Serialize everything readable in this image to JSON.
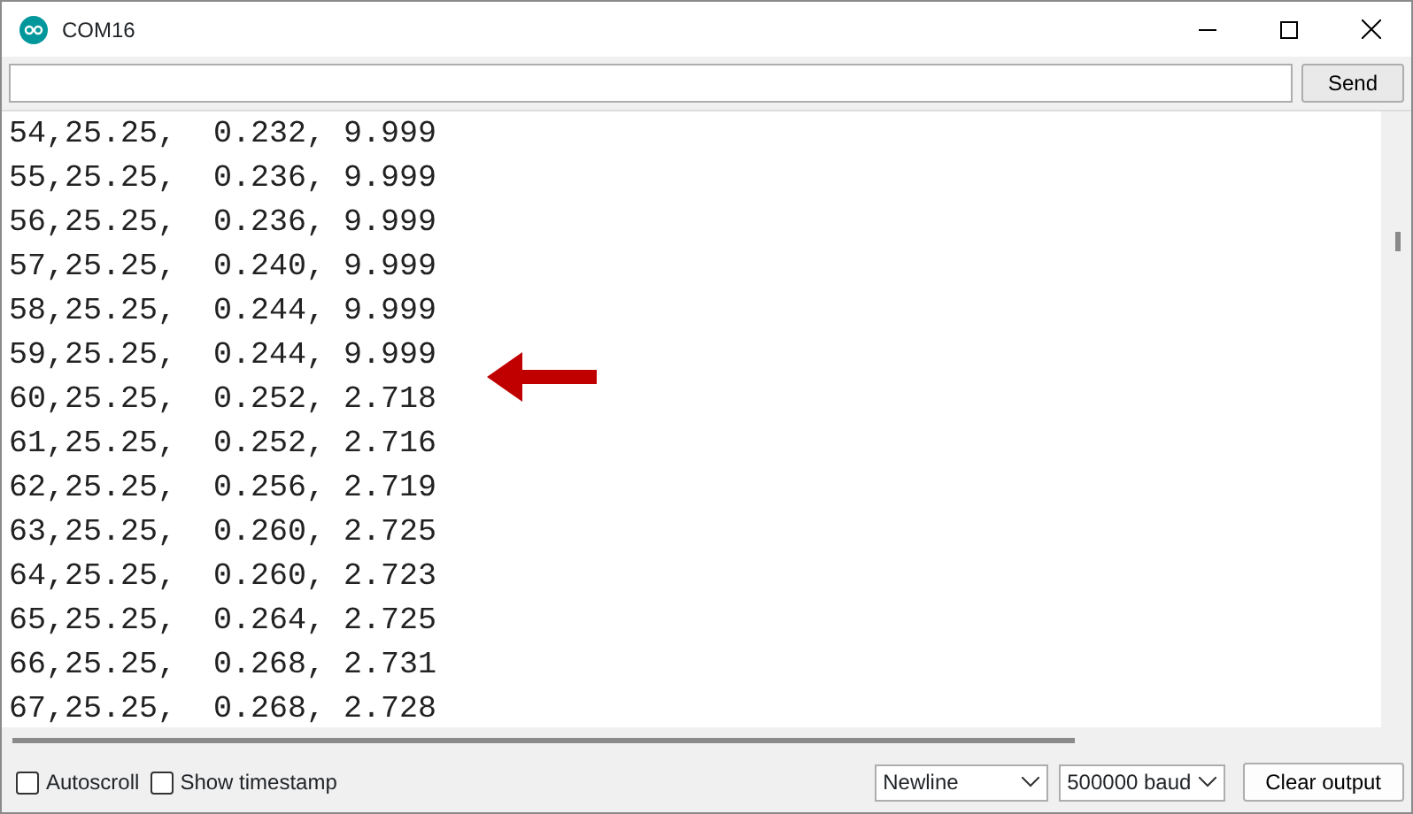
{
  "window": {
    "title": "COM16"
  },
  "send_button": "Send",
  "output_lines": [
    "54,25.25,  0.232, 9.999",
    "55,25.25,  0.236, 9.999",
    "56,25.25,  0.236, 9.999",
    "57,25.25,  0.240, 9.999",
    "58,25.25,  0.244, 9.999",
    "59,25.25,  0.244, 9.999",
    "60,25.25,  0.252, 2.718",
    "61,25.25,  0.252, 2.716",
    "62,25.25,  0.256, 2.719",
    "63,25.25,  0.260, 2.725",
    "64,25.25,  0.260, 2.723",
    "65,25.25,  0.264, 2.725",
    "66,25.25,  0.268, 2.731",
    "67,25.25,  0.268, 2.728"
  ],
  "options": [
    {
      "label": "Autoscroll",
      "checked": false
    },
    {
      "label": "Show timestamp",
      "checked": false
    }
  ],
  "line_ending": "Newline",
  "baud_rate": "500000 baud",
  "clear_button": "Clear output"
}
